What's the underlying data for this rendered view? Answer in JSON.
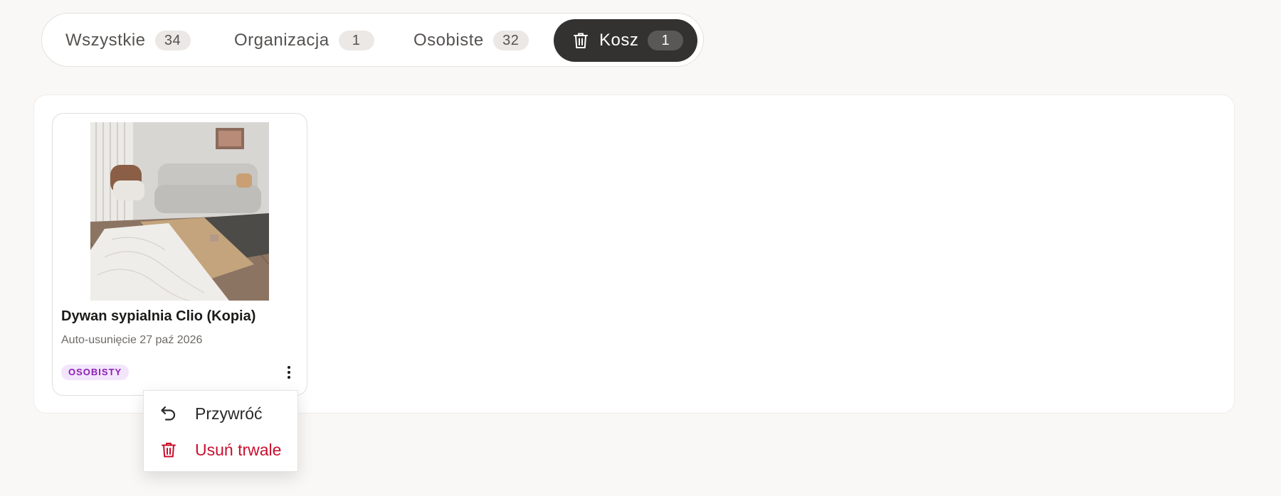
{
  "tabs": [
    {
      "label": "Wszystkie",
      "count": "34"
    },
    {
      "label": "Organizacja",
      "count": "1"
    },
    {
      "label": "Osobiste",
      "count": "32"
    },
    {
      "label": "Kosz",
      "count": "1",
      "icon": "trash-icon",
      "active": true
    }
  ],
  "card": {
    "title": "Dywan sypialnia Clio (Kopia)",
    "meta": "Auto-usunięcie 27 paź 2026",
    "badge": "OSOBISTY",
    "image": "living-room-rug-photo"
  },
  "menu": {
    "restore_label": "Przywróć",
    "restore_icon": "undo-icon",
    "delete_label": "Usuń trwale",
    "delete_icon": "trash-icon"
  },
  "colors": {
    "active_tab": "#333231",
    "badge_bg": "#f3e5fb",
    "badge_text": "#8a1fb3",
    "danger": "#c8102e"
  }
}
